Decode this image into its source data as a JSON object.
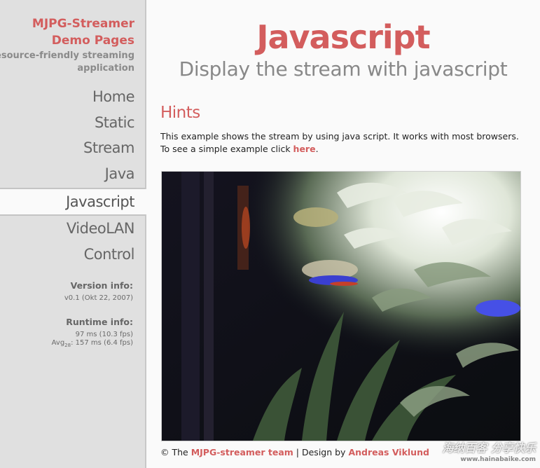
{
  "brand": {
    "title_line1": "MJPG-Streamer",
    "title_line2": "Demo Pages",
    "tagline_line1": "a resource-friendly streaming",
    "tagline_line2": "application"
  },
  "nav": {
    "items": [
      {
        "label": "Home"
      },
      {
        "label": "Static"
      },
      {
        "label": "Stream"
      },
      {
        "label": "Java"
      },
      {
        "label": "Javascript",
        "active": true
      },
      {
        "label": "VideoLAN"
      },
      {
        "label": "Control"
      }
    ]
  },
  "version": {
    "heading": "Version info:",
    "value": "v0.1 (Okt 22, 2007)"
  },
  "runtime": {
    "heading": "Runtime info:",
    "line1": "97 ms (10.3 fps)",
    "avg_label": "Avg",
    "avg_sub": "28",
    "line2_rest": ": 157 ms (6.4 fps)"
  },
  "main": {
    "title": "Javascript",
    "subtitle": "Display the stream with javascript",
    "hints_title": "Hints",
    "hints_line1": "This example shows the stream by using java script. It works with most browsers.",
    "hints_line2_prefix": "To see a simple example click ",
    "hints_link": "here",
    "hints_line2_suffix": "."
  },
  "footer": {
    "prefix": "© The ",
    "team_link": "MJPG-streamer team",
    "middle": " | Design by ",
    "designer_link": "Andreas Viklund"
  },
  "watermark": {
    "main": "海纳百客 分享快乐",
    "url": "www.hainabaike.com"
  },
  "colors": {
    "accent": "#d35d5d",
    "sidebar_bg": "#e0e0e0",
    "page_bg": "#fafafa"
  }
}
